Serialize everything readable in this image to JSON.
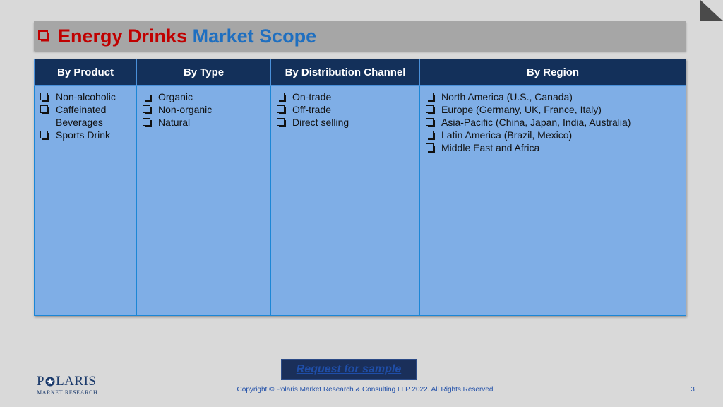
{
  "slide": {
    "title_part1": "Energy Drinks",
    "title_part2": "Market Scope"
  },
  "table": {
    "columns": [
      {
        "header": "By Product",
        "items": [
          "Non-alcoholic",
          "Caffeinated Beverages",
          "Sports Drink"
        ]
      },
      {
        "header": "By Type",
        "items": [
          "Organic",
          "Non-organic",
          "Natural"
        ]
      },
      {
        "header": "By Distribution Channel",
        "items": [
          "On-trade",
          "Off-trade",
          "Direct selling"
        ]
      },
      {
        "header": "By Region",
        "items": [
          "North America (U.S., Canada)",
          "Europe (Germany, UK, France, Italy)",
          "Asia-Pacific (China, Japan, India, Australia)",
          "Latin America (Brazil, Mexico)",
          "Middle East and Africa"
        ]
      }
    ]
  },
  "footer": {
    "button_label": "Request for sample",
    "logo_main": "P LARIS",
    "logo_sub": "MARKET RESEARCH",
    "copyright": "Copyright © Polaris Market Research & Consulting LLP 2022. All Rights Reserved",
    "page_number": "3"
  },
  "colors": {
    "title_red": "#c00000",
    "title_blue": "#1f6fc0",
    "header_bg": "#13305a",
    "cell_bg": "#7faee6",
    "page_bg": "#d9d9d9"
  },
  "icons": {
    "bullet": "checkbox-bullet-icon",
    "corner": "corner-triangle-icon",
    "logo_star": "star-icon"
  }
}
